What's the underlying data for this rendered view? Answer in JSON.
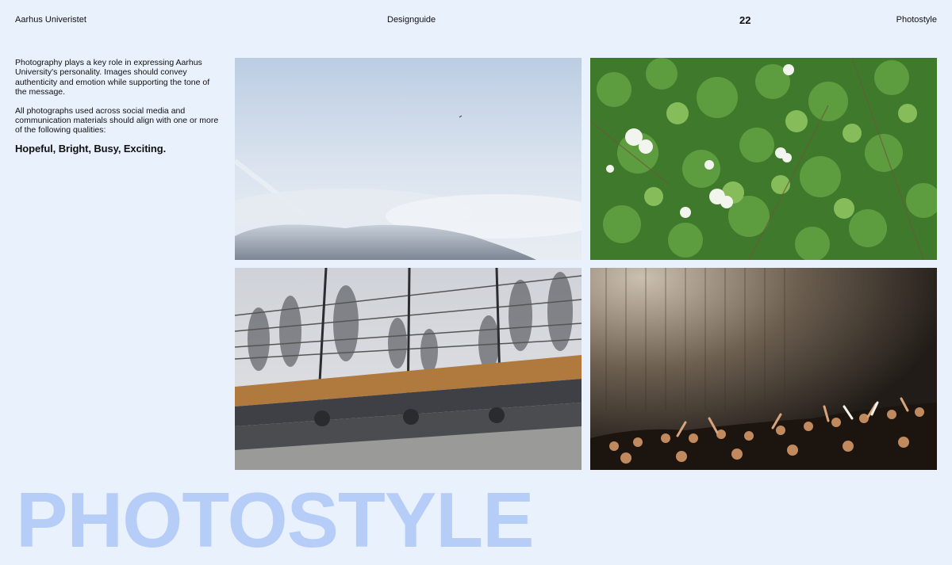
{
  "header": {
    "org": "Aarhus Univeristet",
    "doc": "Designguide",
    "page_number": "22",
    "section": "Photostyle"
  },
  "intro": {
    "p1": "Photography plays a key role in expressing Aarhus University's personality. Images should convey authenticity and emotion while supporting the tone of the message.",
    "p2": "All photographs used across social media and communication materials should align with one or more of the following qualities:",
    "qualities": "Hopeful, Bright, Busy, Exciting."
  },
  "photos": [
    {
      "subject": "sky-clouds"
    },
    {
      "subject": "green-leaves-flowers"
    },
    {
      "subject": "people-walking-bridge"
    },
    {
      "subject": "concert-crowd"
    }
  ],
  "big_title": "PHOTOSTYLE",
  "colors": {
    "background": "#e9f1fd",
    "big_title": "#b5cdf7",
    "text": "#111111"
  }
}
